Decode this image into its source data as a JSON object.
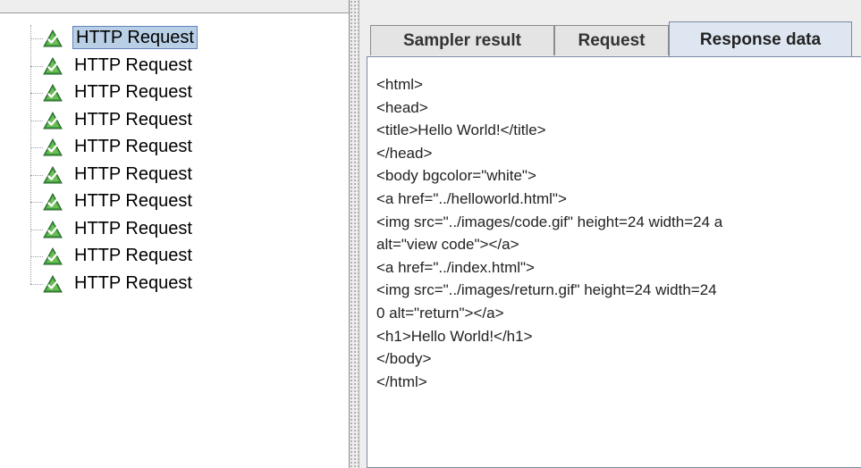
{
  "tree": {
    "items": [
      {
        "label": "HTTP Request",
        "selected": true,
        "icon": "success-triangle-icon"
      },
      {
        "label": "HTTP Request",
        "selected": false,
        "icon": "success-triangle-icon"
      },
      {
        "label": "HTTP Request",
        "selected": false,
        "icon": "success-triangle-icon"
      },
      {
        "label": "HTTP Request",
        "selected": false,
        "icon": "success-triangle-icon"
      },
      {
        "label": "HTTP Request",
        "selected": false,
        "icon": "success-triangle-icon"
      },
      {
        "label": "HTTP Request",
        "selected": false,
        "icon": "success-triangle-icon"
      },
      {
        "label": "HTTP Request",
        "selected": false,
        "icon": "success-triangle-icon"
      },
      {
        "label": "HTTP Request",
        "selected": false,
        "icon": "success-triangle-icon"
      },
      {
        "label": "HTTP Request",
        "selected": false,
        "icon": "success-triangle-icon"
      },
      {
        "label": "HTTP Request",
        "selected": false,
        "icon": "success-triangle-icon"
      }
    ]
  },
  "tabs": [
    {
      "label": "Sampler result",
      "active": false
    },
    {
      "label": "Request",
      "active": false
    },
    {
      "label": "Response data",
      "active": true
    }
  ],
  "response": {
    "lines": [
      "<html>",
      "<head>",
      "<title>Hello World!</title>",
      "</head>",
      "<body bgcolor=\"white\">",
      "<a href=\"../helloworld.html\">",
      "<img src=\"../images/code.gif\" height=24 width=24 a",
      "alt=\"view code\"></a>",
      "<a href=\"../index.html\">",
      "<img src=\"../images/return.gif\" height=24 width=24",
      "0 alt=\"return\"></a>",
      "<h1>Hello World!</h1>",
      "</body>",
      "</html>"
    ]
  },
  "colors": {
    "selection": "#b8cfe5",
    "icon_green": "#3aa13a",
    "tab_active": "#dee7f1"
  }
}
